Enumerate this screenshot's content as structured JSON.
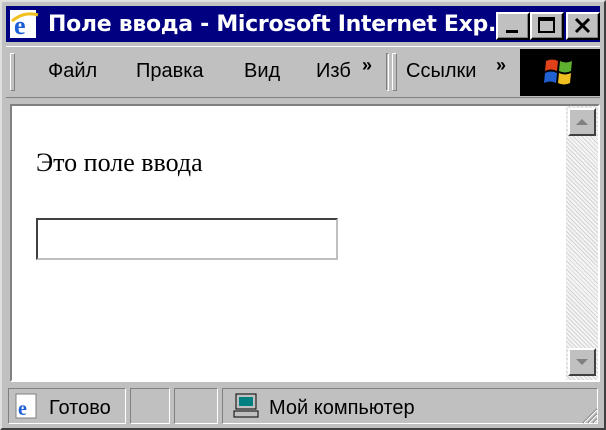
{
  "window": {
    "title": "Поле ввода - Microsoft Internet Exp...",
    "icon": "ie-icon"
  },
  "menubar": {
    "items": [
      "Файл",
      "Правка",
      "Вид",
      "Изб"
    ],
    "overflow": "»",
    "links_label": "Ссылки",
    "links_overflow": "»"
  },
  "page": {
    "text": "Это поле ввода",
    "input_value": ""
  },
  "status": {
    "state": "Готово",
    "zone": "Мой компьютер"
  },
  "colors": {
    "titlebar": "#000080",
    "chrome": "#c0c0c0",
    "content_bg": "#ffffff"
  }
}
